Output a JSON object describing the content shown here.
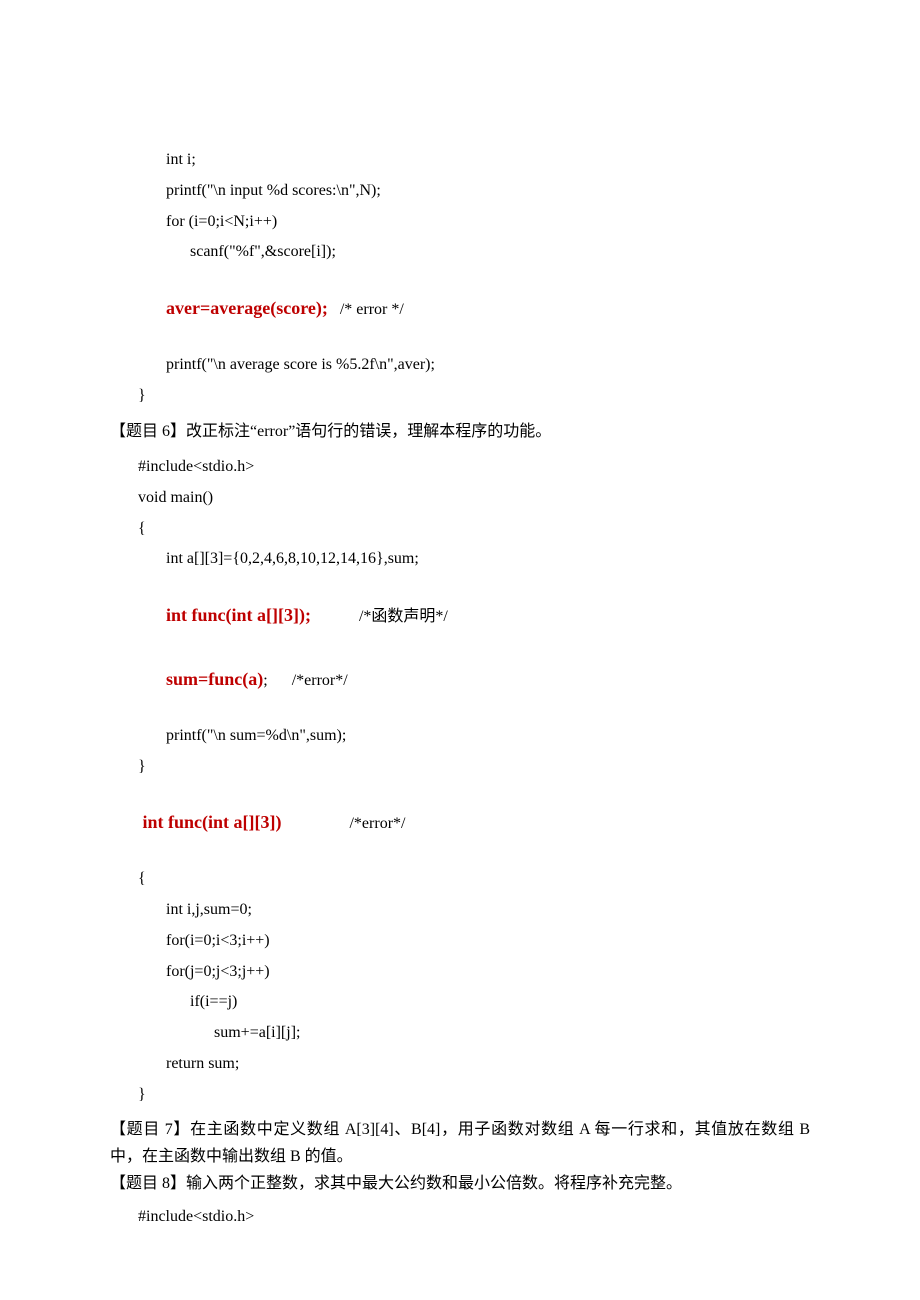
{
  "code1": {
    "l1": "int i;",
    "l2": "printf(\"\\n input %d scores:\\n\",N);",
    "l3": "for (i=0;i<N;i++)",
    "l4": "scanf(\"%f\",&score[i]);",
    "l5_red": "aver=average(score);",
    "l5_c": "   /* error */",
    "l6": "printf(\"\\n average score is %5.2f\\n\",aver);",
    "l7": "}"
  },
  "q6_title": "【题目 6】改正标注“error”语句行的错误，理解本程序的功能。",
  "code2": {
    "l1": "#include<stdio.h>",
    "l2": "void main()",
    "l3": "{",
    "l4": "int a[][3]={0,2,4,6,8,10,12,14,16},sum;",
    "l5_red": "int func(int a[][3]);",
    "l5_c": "            /*函数声明*/",
    "l6_red": "sum=func(a)",
    "l6_after": ";      /*error*/",
    "l7": "printf(\"\\n sum=%d\\n\",sum);",
    "l8": "}",
    "l9_red": " int func(int a[][3])",
    "l9_c": "                 /*error*/",
    "l10": "{",
    "l11": "int i,j,sum=0;",
    "l12": "for(i=0;i<3;i++)",
    "l13": "for(j=0;j<3;j++)",
    "l14": "if(i==j)",
    "l15": "sum+=a[i][j];",
    "l16": "return sum;",
    "l17": "}"
  },
  "q7_text": "【题目 7】在主函数中定义数组 A[3][4]、B[4]，用子函数对数组 A 每一行求和，其值放在数组 B 中，在主函数中输出数组 B 的值。",
  "q8_text": "【题目 8】输入两个正整数，求其中最大公约数和最小公倍数。将程序补充完整。",
  "code3": {
    "l1": "#include<stdio.h>"
  }
}
